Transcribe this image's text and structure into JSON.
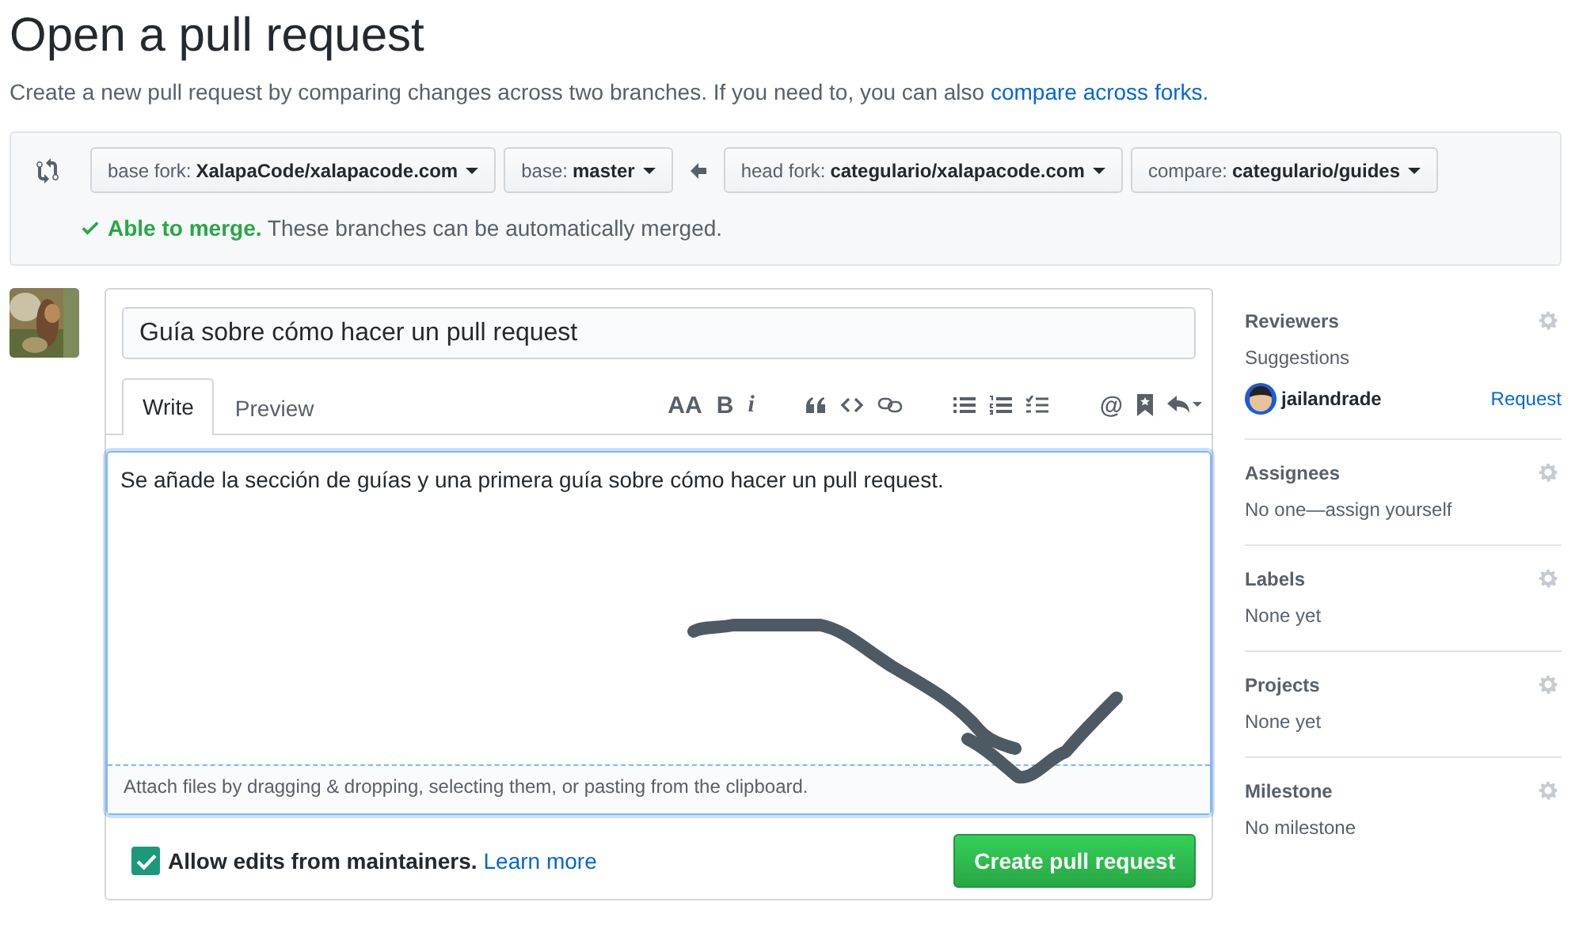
{
  "page_title": "Open a pull request",
  "subtitle": {
    "text": "Create a new pull request by comparing changes across two branches. If you need to, you can also ",
    "link": "compare across forks."
  },
  "compare": {
    "branches": [
      {
        "prefix": "base fork:",
        "value": "XalapaCode/xalapacode.com"
      },
      {
        "prefix": "base:",
        "value": "master"
      },
      {
        "prefix": "head fork:",
        "value": "categulario/xalapacode.com"
      },
      {
        "prefix": "compare:",
        "value": "categulario/guides"
      }
    ],
    "merge_status": {
      "ok": true,
      "headline": "Able to merge.",
      "detail": "These branches can be automatically merged."
    }
  },
  "form": {
    "title_value": "Guía sobre cómo hacer un pull request",
    "tabs": [
      {
        "label": "Write",
        "selected": true
      },
      {
        "label": "Preview",
        "selected": false
      }
    ],
    "toolbar_glyphs": [
      "AA",
      "B",
      "i",
      "@"
    ],
    "body": "Se añade la sección de guías y una primera guía sobre cómo hacer un pull request.",
    "attach_hint": "Attach files by dragging & dropping, selecting them, or pasting from the clipboard.",
    "allow_edits": {
      "checked": true,
      "label": "Allow edits from maintainers.",
      "link": "Learn more"
    },
    "submit": "Create pull request"
  },
  "sidebar": [
    {
      "heading": "Reviewers",
      "subheading": "Suggestions",
      "reviewer": {
        "name": "jailandrade",
        "action": "Request"
      }
    },
    {
      "heading": "Assignees",
      "value": "No one—assign yourself"
    },
    {
      "heading": "Labels",
      "value": "None yet"
    },
    {
      "heading": "Projects",
      "value": "None yet"
    },
    {
      "heading": "Milestone",
      "value": "No milestone"
    }
  ]
}
